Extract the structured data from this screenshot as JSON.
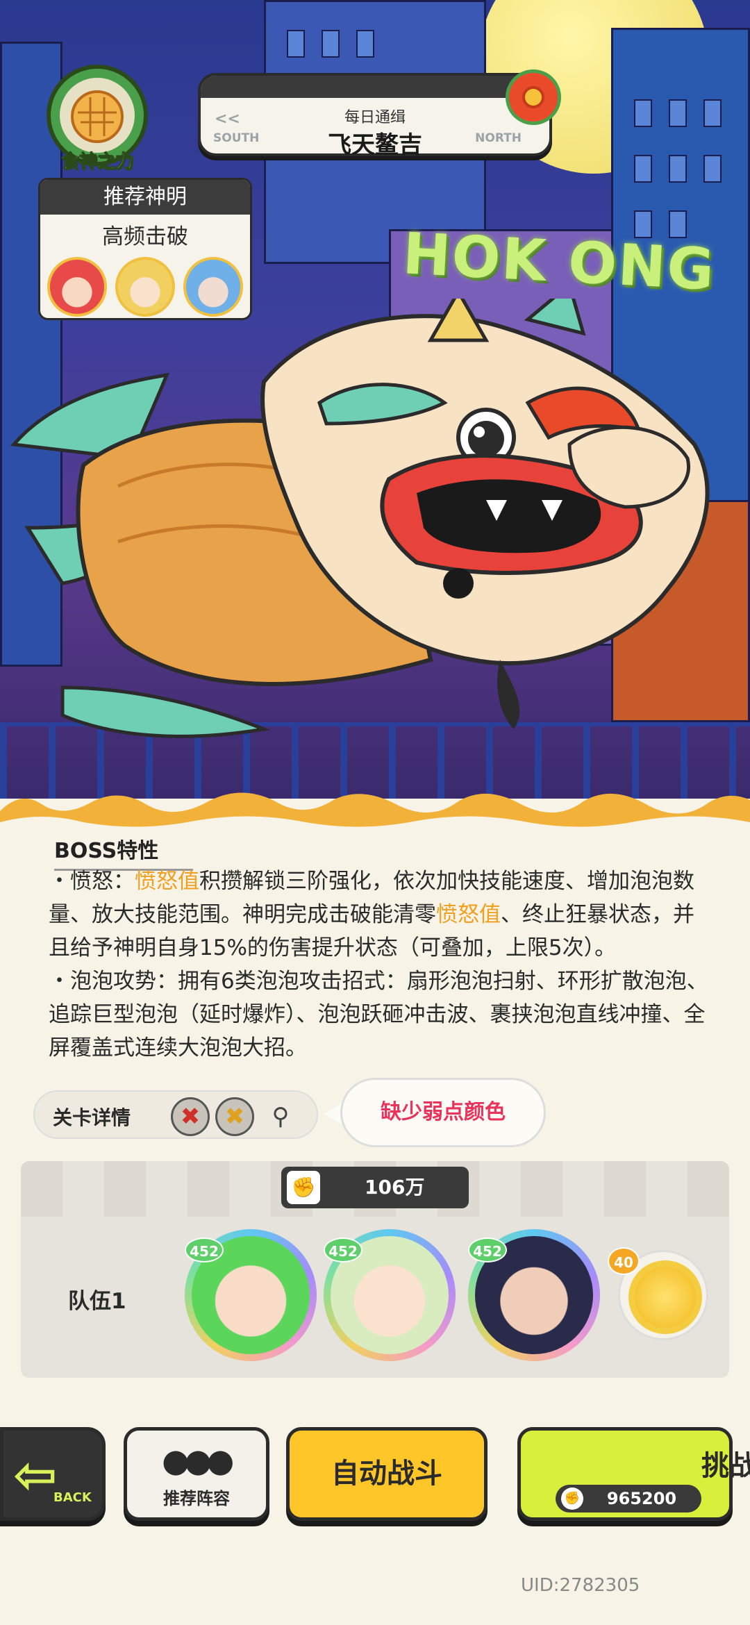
{
  "header": {
    "force_label": "食神之力",
    "title_sub": "每日通缉",
    "title_main": "飞天鳌吉",
    "dir_left": "SOUTH",
    "dir_right": "NORTH",
    "chevron": "<<"
  },
  "scene": {
    "neon_sign": "HOK ONG"
  },
  "recommended": {
    "heading": "推荐神明",
    "subtitle": "高频击破",
    "avatars": [
      "red-hair-god-avatar",
      "blonde-god-avatar",
      "blue-hair-god-avatar"
    ]
  },
  "boss": {
    "section_title": "BOSS特性",
    "rage_prefix": "・愤怒：",
    "rage_kw1": "愤怒值",
    "rage_mid": "积攒解锁三阶强化，依次加快技能速度、增加泡泡数量、放大技能范围。神明完成击破能清零",
    "rage_kw2": "愤怒值",
    "rage_suffix": "、终止狂暴状态，并且给予神明自身15%的伤害提升状态（可叠加，上限5次）。",
    "bubble_attack": "・泡泡攻势：拥有6类泡泡攻击招式：扇形泡泡扫射、环形扩散泡泡、追踪巨型泡泡（延时爆炸）、泡泡跃砸冲击波、裹挟泡泡直线冲撞、全屏覆盖式连续大泡泡大招。"
  },
  "level": {
    "label": "关卡详情",
    "missing_weakness": "缺少弱点颜色",
    "icon_red": "✖",
    "icon_gold": "✖",
    "icon_search": "⚲"
  },
  "team": {
    "power": "106万",
    "label": "队伍1",
    "members": [
      {
        "level": "452"
      },
      {
        "level": "452"
      },
      {
        "level": "452"
      }
    ],
    "pet_level": "40"
  },
  "buttons": {
    "back": "BACK",
    "lineup": "推荐阵容",
    "auto": "自动战斗",
    "challenge": "挑战",
    "challenge_power": "965200"
  },
  "footer": {
    "uid": "UID:2782305"
  },
  "colors": {
    "highlight": "#f0a020",
    "weakness_text": "#e8335c",
    "auto_button": "#ffc62a",
    "challenge_button": "#d8f03c"
  }
}
